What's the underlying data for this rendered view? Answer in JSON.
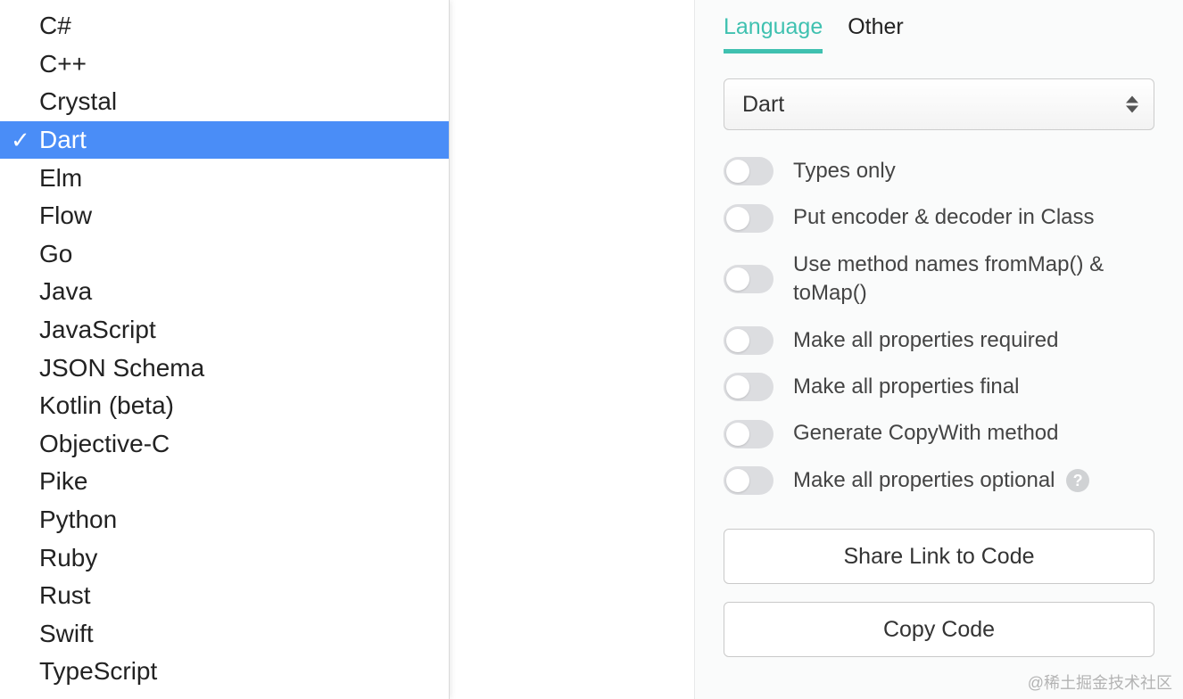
{
  "dropdown": {
    "selected_index": 3,
    "items": [
      "C#",
      "C++",
      "Crystal",
      "Dart",
      "Elm",
      "Flow",
      "Go",
      "Java",
      "JavaScript",
      "JSON Schema",
      "Kotlin (beta)",
      "Objective-C",
      "Pike",
      "Python",
      "Ruby",
      "Rust",
      "Swift",
      "TypeScript"
    ]
  },
  "tabs": {
    "active_index": 0,
    "items": [
      "Language",
      "Other"
    ]
  },
  "select": {
    "value": "Dart"
  },
  "toggles": [
    {
      "label": "Types only",
      "checked": false,
      "help": false
    },
    {
      "label": "Put encoder & decoder in Class",
      "checked": false,
      "help": false
    },
    {
      "label": "Use method names fromMap() & toMap()",
      "checked": false,
      "help": false
    },
    {
      "label": "Make all properties required",
      "checked": false,
      "help": false
    },
    {
      "label": "Make all properties final",
      "checked": false,
      "help": false
    },
    {
      "label": "Generate CopyWith method",
      "checked": false,
      "help": false
    },
    {
      "label": "Make all properties optional",
      "checked": false,
      "help": true
    }
  ],
  "buttons": {
    "share": "Share Link to Code",
    "copy": "Copy Code"
  },
  "watermark": "@稀土掘金技术社区"
}
